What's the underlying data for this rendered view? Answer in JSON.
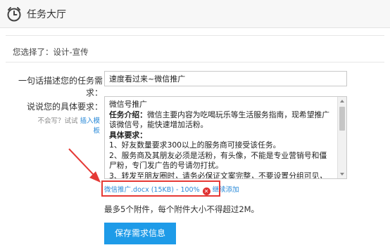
{
  "header": {
    "title": "任务大厅",
    "icon": "clock-icon"
  },
  "selection": {
    "text": "您选择了：设计-宣传"
  },
  "form": {
    "summary_label": "一句话描述您的任务需求：",
    "summary_value": "速度看过来~微信推广",
    "detail_label": "说说您的具体要求：",
    "help_prefix": "不会写？试试",
    "help_link": "插入模板",
    "detail_lines": [
      {
        "text": "微信号推广",
        "bold": false
      },
      {
        "text": "任务介绍：",
        "bold": true,
        "rest": "微信主要内容为吃喝玩乐等生活服务指南，现希望推广该微信号，能快速增加活粉。"
      },
      {
        "text": "具体要求：",
        "bold": true
      },
      {
        "text": "1、好友数量要求300以上的服务商可接受该任务。",
        "bold": false
      },
      {
        "text": "2、服务商及其朋友必须是活粉，有头像，不能是专业营销号和僵尸粉，专门发广告的号请勿打扰。",
        "bold": false
      },
      {
        "text": "3、转发至朋友圈时，请务必保证文案完整，不要设置分组可见，一定要公开",
        "bold": false
      }
    ]
  },
  "attachment": {
    "file": "微信推广.docx (15KB) - 100%",
    "delete_icon": "close-circle-icon",
    "continue_label": "继续添加",
    "limit_text": "最多5个附件，每个附件大小不得超过2M。"
  },
  "actions": {
    "save_label": "保存需求信息"
  },
  "colors": {
    "accent": "#1e9be8",
    "highlight": "#e53935",
    "link": "#2a8ad8"
  }
}
